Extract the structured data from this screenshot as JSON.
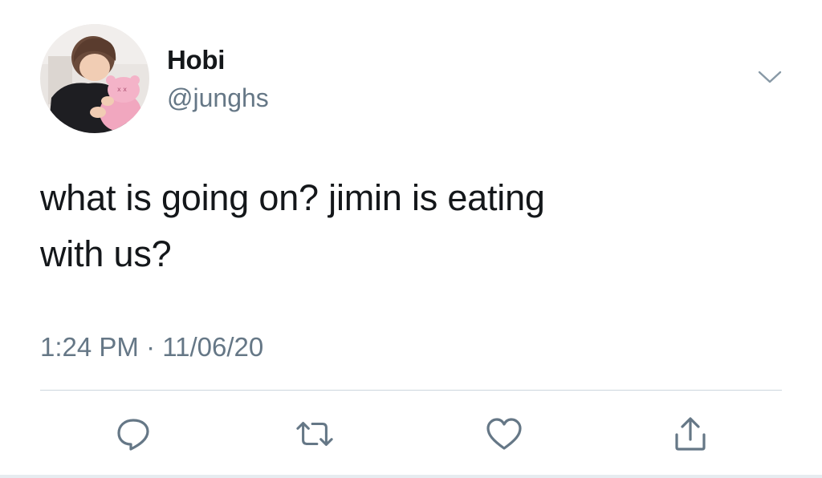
{
  "author": {
    "display_name": "Hobi",
    "handle": "@junghs",
    "avatar_icon": "profile-photo"
  },
  "tweet": {
    "text_line1": "what is going on? jimin is eating",
    "text_line2": "with us?"
  },
  "meta": {
    "time": "1:24 PM",
    "separator": "·",
    "date": "11/06/20"
  },
  "actions": {
    "reply_icon": "reply-icon",
    "retweet_icon": "retweet-icon",
    "like_icon": "heart-icon",
    "share_icon": "share-icon"
  },
  "colors": {
    "text_primary": "#14171a",
    "text_secondary": "#657786",
    "icon": "#657786",
    "divider": "#ccd6dd"
  }
}
